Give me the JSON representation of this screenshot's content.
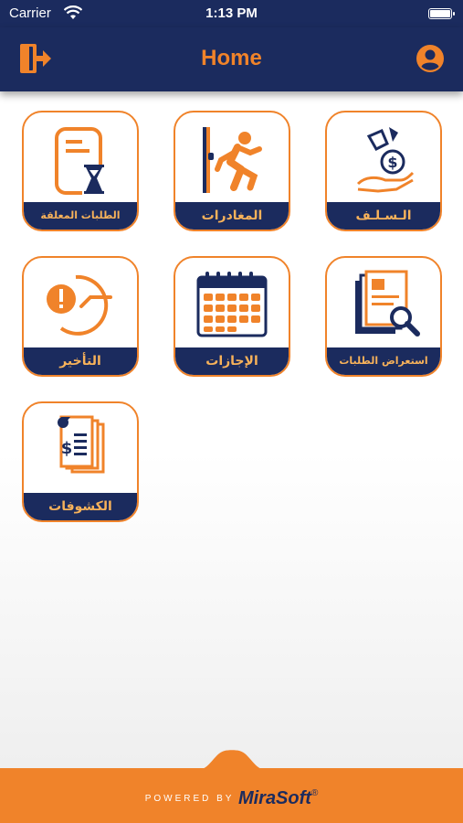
{
  "status_bar": {
    "carrier": "Carrier",
    "time": "1:13 PM",
    "wifi_icon": "wifi-icon",
    "battery_icon": "battery-icon"
  },
  "nav": {
    "title": "Home",
    "logout_icon": "logout-icon",
    "profile_icon": "profile-icon"
  },
  "tiles": [
    {
      "label": "الـسـلـف",
      "icon": "money-hand-icon"
    },
    {
      "label": "المغادرات",
      "icon": "exit-runner-icon"
    },
    {
      "label": "الطلبات المعلقة",
      "icon": "pending-hourglass-icon"
    },
    {
      "label": "استعراض الطلبات",
      "icon": "review-documents-icon"
    },
    {
      "label": "الإجازات",
      "icon": "calendar-icon"
    },
    {
      "label": "التأخير",
      "icon": "late-clock-icon"
    },
    {
      "label": "الكشوفات",
      "icon": "statements-icon"
    }
  ],
  "footer": {
    "powered_by": "POWERED BY",
    "brand": "MiraSoft",
    "registered": "®"
  },
  "colors": {
    "navy": "#1b2b5e",
    "orange": "#f0832a",
    "label_text": "#f7b25a"
  }
}
